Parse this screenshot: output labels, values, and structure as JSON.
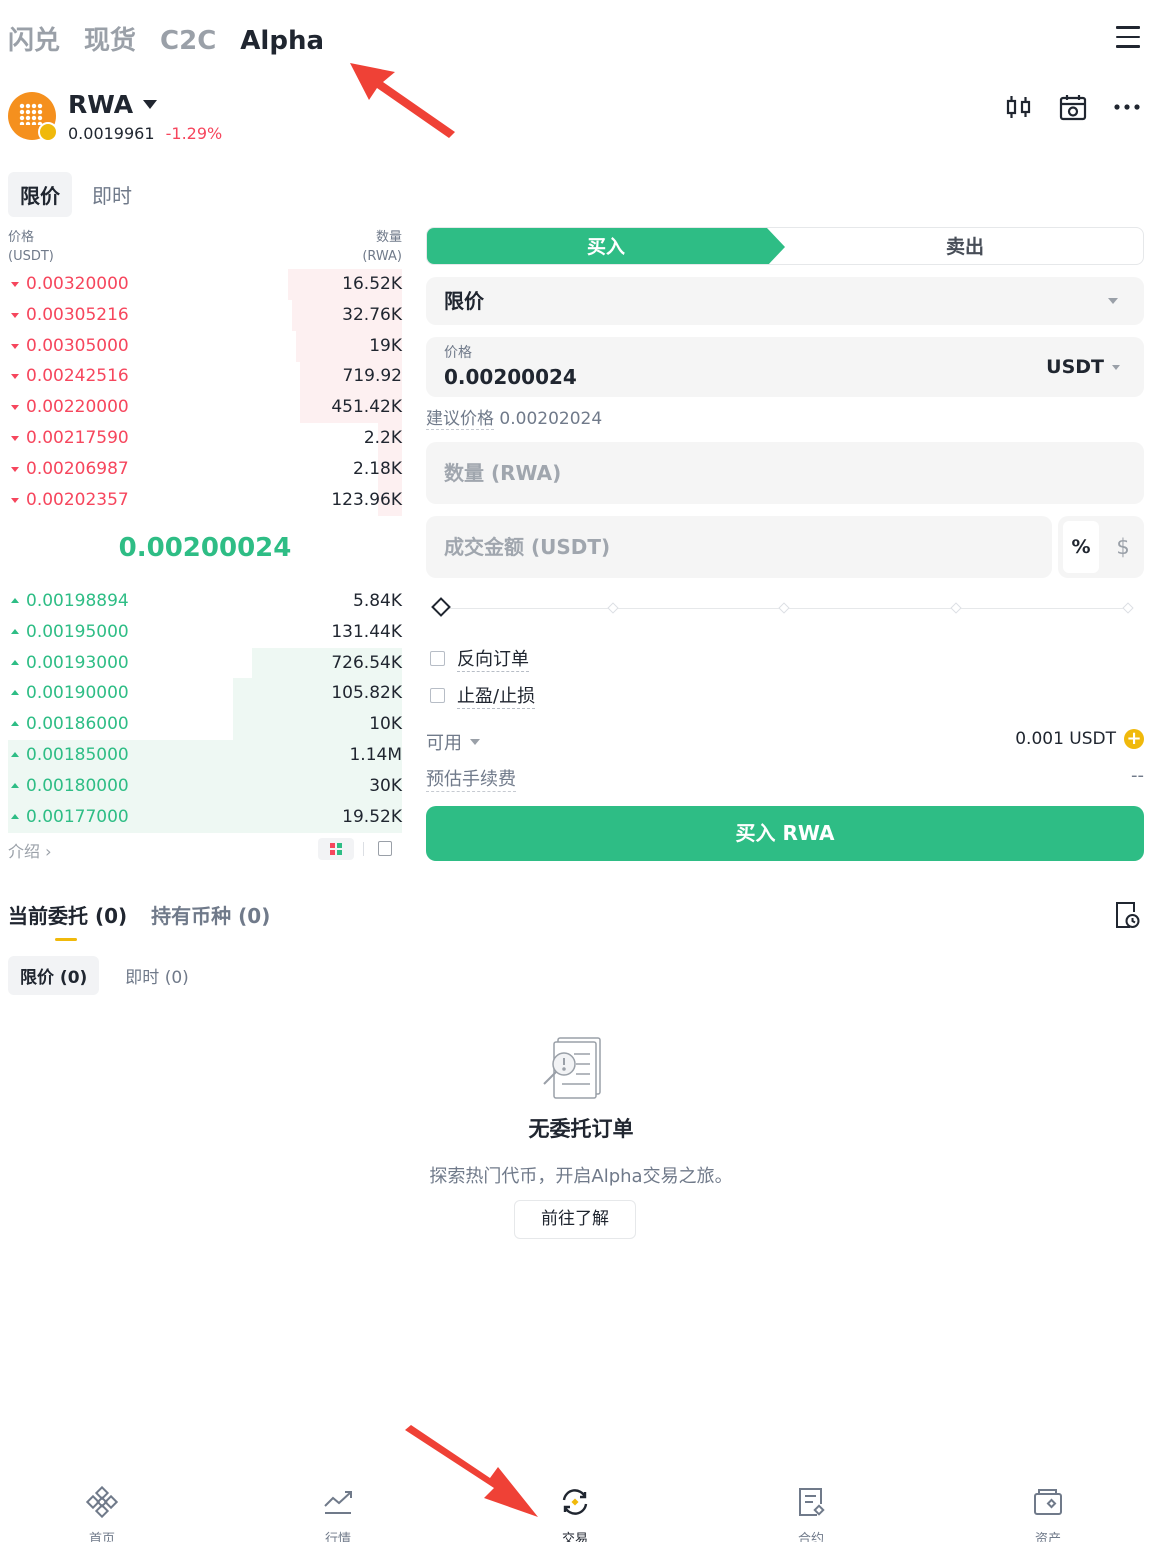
{
  "top_nav": {
    "tabs": [
      "闪兑",
      "现货",
      "C2C",
      "Alpha"
    ],
    "active": "Alpha"
  },
  "token": {
    "symbol": "RWA",
    "price": "0.0019961",
    "change": "-1.29%"
  },
  "order_tabs": [
    "限价",
    "即时"
  ],
  "orderbook": {
    "header_price": "价格",
    "header_price_unit": "(USDT)",
    "header_qty": "数量",
    "header_qty_unit": "(RWA)",
    "asks": [
      {
        "price": "0.00320000",
        "qty": "16.52K",
        "depth": 0.29
      },
      {
        "price": "0.00305216",
        "qty": "32.76K",
        "depth": 0.28
      },
      {
        "price": "0.00305000",
        "qty": "19K",
        "depth": 0.27
      },
      {
        "price": "0.00242516",
        "qty": "719.92",
        "depth": 0.26
      },
      {
        "price": "0.00220000",
        "qty": "451.42K",
        "depth": 0.26
      },
      {
        "price": "0.00217590",
        "qty": "2.2K",
        "depth": 0.06
      },
      {
        "price": "0.00206987",
        "qty": "2.18K",
        "depth": 0.06
      },
      {
        "price": "0.00202357",
        "qty": "123.96K",
        "depth": 0.06
      }
    ],
    "mid_price": "0.00200024",
    "bids": [
      {
        "price": "0.00198894",
        "qty": "5.84K",
        "depth": 0.0
      },
      {
        "price": "0.00195000",
        "qty": "131.44K",
        "depth": 0.0
      },
      {
        "price": "0.00193000",
        "qty": "726.54K",
        "depth": 0.38
      },
      {
        "price": "0.00190000",
        "qty": "105.82K",
        "depth": 0.43
      },
      {
        "price": "0.00186000",
        "qty": "10K",
        "depth": 0.43
      },
      {
        "price": "0.00185000",
        "qty": "1.14M",
        "depth": 1.0
      },
      {
        "price": "0.00180000",
        "qty": "30K",
        "depth": 1.0
      },
      {
        "price": "0.00177000",
        "qty": "19.52K",
        "depth": 1.0
      }
    ],
    "intro_label": "介绍 ›"
  },
  "trade_form": {
    "buy_label": "买入",
    "sell_label": "卖出",
    "order_type": "限价",
    "price_label": "价格",
    "price_value": "0.00200024",
    "price_unit": "USDT",
    "suggest_label": "建议价格",
    "suggest_value": "0.00202024",
    "qty_placeholder": "数量 (RWA)",
    "amount_placeholder": "成交金额 (USDT)",
    "pct_label": "%",
    "usd_label": "$",
    "reverse_order": "反向订单",
    "tp_sl": "止盈/止损",
    "available_label": "可用",
    "available_value": "0.001 USDT",
    "fee_label": "预估手续费",
    "fee_value": "--",
    "submit_label": "买入 RWA"
  },
  "orders": {
    "tabs": [
      "当前委托 (0)",
      "持有币种 (0)"
    ],
    "subtabs": [
      "限价 (0)",
      "即时 (0)"
    ],
    "empty_title": "无委托订单",
    "empty_desc": "探索热门代币，开启Alpha交易之旅。",
    "learn_button": "前往了解"
  },
  "bottom_nav": [
    "首页",
    "行情",
    "交易",
    "合约",
    "资产"
  ],
  "colors": {
    "green": "#2ebd85",
    "red": "#f6465d",
    "yellow": "#f0b90b",
    "annotation": "#ef4136"
  }
}
